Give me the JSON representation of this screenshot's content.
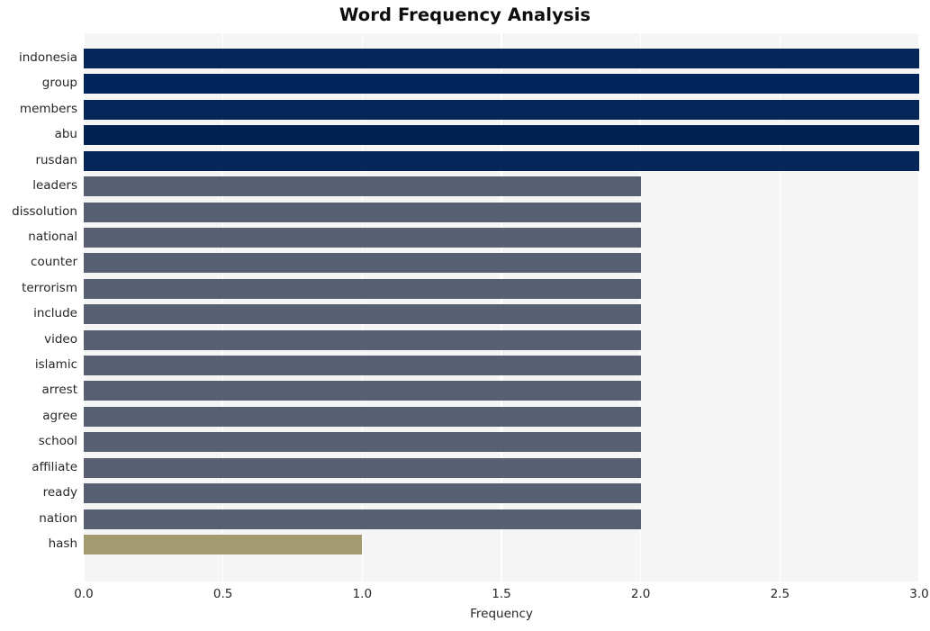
{
  "chart_data": {
    "type": "bar",
    "orientation": "horizontal",
    "title": "Word Frequency Analysis",
    "xlabel": "Frequency",
    "ylabel": "",
    "xlim": [
      0.0,
      3.0
    ],
    "xticks": [
      "0.0",
      "0.5",
      "1.0",
      "1.5",
      "2.0",
      "2.5",
      "3.0"
    ],
    "xtick_values": [
      0.0,
      0.5,
      1.0,
      1.5,
      2.0,
      2.5,
      3.0
    ],
    "grid": "vertical-white",
    "legend": "none",
    "categories": [
      "indonesia",
      "group",
      "members",
      "abu",
      "rusdan",
      "leaders",
      "dissolution",
      "national",
      "counter",
      "terrorism",
      "include",
      "video",
      "islamic",
      "arrest",
      "agree",
      "school",
      "affiliate",
      "ready",
      "nation",
      "hash"
    ],
    "values": [
      3,
      3,
      3,
      3,
      3,
      2,
      2,
      2,
      2,
      2,
      2,
      2,
      2,
      2,
      2,
      2,
      2,
      2,
      2,
      1
    ],
    "bar_colors": [
      "#06265a",
      "#00245c",
      "#06265a",
      "#002253",
      "#062659",
      "#575f72",
      "#575f72",
      "#575f72",
      "#575f72",
      "#575f72",
      "#575f72",
      "#575f72",
      "#575f72",
      "#575f72",
      "#575f72",
      "#575f72",
      "#575f72",
      "#575f72",
      "#575f72",
      "#a49a6f"
    ],
    "colors": {
      "navy": "#06265a",
      "slate": "#575f72",
      "tan": "#a49a6f",
      "plot_background": "#f5f5f6",
      "figure_background": "#ffffff",
      "gridline": "#ffffff",
      "text": "#262626",
      "title_text": "#0d0d0d"
    }
  }
}
